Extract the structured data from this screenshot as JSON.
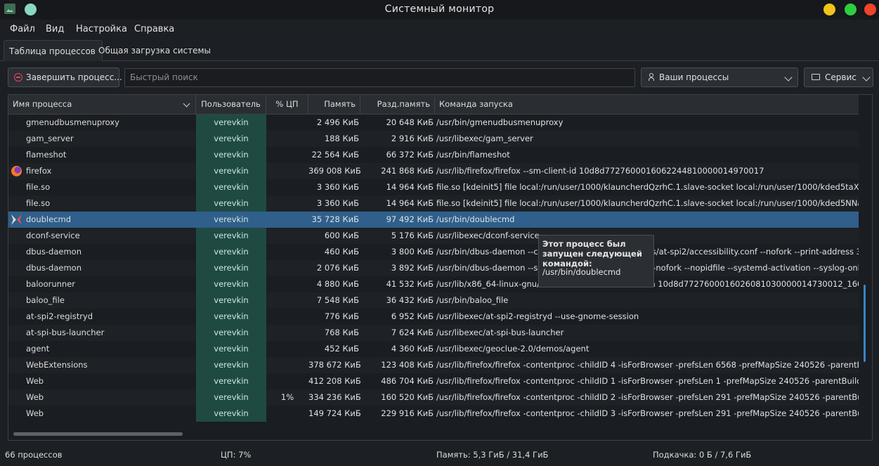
{
  "window": {
    "title": "Системный монитор"
  },
  "menu": [
    "Файл",
    "Вид",
    "Настройка",
    "Справка"
  ],
  "tabs": [
    "Таблица процессов",
    "Общая загрузка системы"
  ],
  "toolbar": {
    "kill_label": "Завершить процесс...",
    "search_placeholder": "Быстрый поиск",
    "filter_label": "Ваши процессы",
    "service_label": "Сервис"
  },
  "columns": [
    "Имя процесса",
    "Пользователь",
    "% ЦП",
    "Память",
    "Разд.память",
    "Команда запуска"
  ],
  "rows": [
    {
      "name": "gmenudbusmenuproxy",
      "user": "verevkin",
      "cpu": "",
      "mem": "2 496 КиБ",
      "shm": "20 648 КиБ",
      "cmd": "/usr/bin/gmenudbusmenuproxy",
      "icon": ""
    },
    {
      "name": "gam_server",
      "user": "verevkin",
      "cpu": "",
      "mem": "188 КиБ",
      "shm": "2 916 КиБ",
      "cmd": "/usr/libexec/gam_server",
      "icon": ""
    },
    {
      "name": "flameshot",
      "user": "verevkin",
      "cpu": "",
      "mem": "22 564 КиБ",
      "shm": "66 372 КиБ",
      "cmd": "/usr/bin/flameshot",
      "icon": ""
    },
    {
      "name": "firefox",
      "user": "verevkin",
      "cpu": "",
      "mem": "369 008 КиБ",
      "shm": "241 868 КиБ",
      "cmd": "/usr/lib/firefox/firefox --sm-client-id 10d8d7727600016062244810000014970017",
      "icon": "firefox-icon"
    },
    {
      "name": "file.so",
      "user": "verevkin",
      "cpu": "",
      "mem": "3 360 КиБ",
      "shm": "14 964 КиБ",
      "cmd": "file.so [kdeinit5] file local:/run/user/1000/klauncherdQzrhC.1.slave-socket local:/run/user/1000/kded5taXxH",
      "icon": ""
    },
    {
      "name": "file.so",
      "user": "verevkin",
      "cpu": "",
      "mem": "3 360 КиБ",
      "shm": "14 964 КиБ",
      "cmd": "file.so [kdeinit5] file local:/run/user/1000/klauncherdQzrhC.1.slave-socket local:/run/user/1000/kded5NNak",
      "icon": ""
    },
    {
      "name": "doublecmd",
      "user": "verevkin",
      "cpu": "",
      "mem": "35 728 КиБ",
      "shm": "97 492 КиБ",
      "cmd": "/usr/bin/doublecmd",
      "icon": "doublecmd-icon",
      "selected": true
    },
    {
      "name": "dconf-service",
      "user": "verevkin",
      "cpu": "",
      "mem": "600 КиБ",
      "shm": "5 176 КиБ",
      "cmd": "/usr/libexec/dconf-service",
      "icon": ""
    },
    {
      "name": "dbus-daemon",
      "user": "verevkin",
      "cpu": "",
      "mem": "460 КиБ",
      "shm": "3 800 КиБ",
      "cmd": "/usr/bin/dbus-daemon --config-file=/usr/share/defaults/at-spi2/accessibility.conf --nofork --print-address 3",
      "icon": ""
    },
    {
      "name": "dbus-daemon",
      "user": "verevkin",
      "cpu": "",
      "mem": "2 076 КиБ",
      "shm": "3 892 КиБ",
      "cmd": "/usr/bin/dbus-daemon --session --address=systemd: --nofork --nopidfile --systemd-activation --syslog-only",
      "icon": ""
    },
    {
      "name": "baloorunner",
      "user": "verevkin",
      "cpu": "",
      "mem": "4 880 КиБ",
      "shm": "41 532 КиБ",
      "cmd": "/usr/lib/x86_64-linux-gnu/libexec/baloorunner -session 10d8d7727600016026081030000014730012_1606",
      "icon": ""
    },
    {
      "name": "baloo_file",
      "user": "verevkin",
      "cpu": "",
      "mem": "7 548 КиБ",
      "shm": "36 432 КиБ",
      "cmd": "/usr/bin/baloo_file",
      "icon": ""
    },
    {
      "name": "at-spi2-registryd",
      "user": "verevkin",
      "cpu": "",
      "mem": "776 КиБ",
      "shm": "6 952 КиБ",
      "cmd": "/usr/libexec/at-spi2-registryd --use-gnome-session",
      "icon": ""
    },
    {
      "name": "at-spi-bus-launcher",
      "user": "verevkin",
      "cpu": "",
      "mem": "768 КиБ",
      "shm": "7 624 КиБ",
      "cmd": "/usr/libexec/at-spi-bus-launcher",
      "icon": ""
    },
    {
      "name": "agent",
      "user": "verevkin",
      "cpu": "",
      "mem": "452 КиБ",
      "shm": "4 360 КиБ",
      "cmd": "/usr/libexec/geoclue-2.0/demos/agent",
      "icon": ""
    },
    {
      "name": "WebExtensions",
      "user": "verevkin",
      "cpu": "",
      "mem": "378 672 КиБ",
      "shm": "123 408 КиБ",
      "cmd": "/usr/lib/firefox/firefox -contentproc -childID 4 -isForBrowser -prefsLen 6568 -prefMapSize 240526 -parentBui",
      "icon": ""
    },
    {
      "name": "Web",
      "user": "verevkin",
      "cpu": "",
      "mem": "412 208 КиБ",
      "shm": "486 704 КиБ",
      "cmd": "/usr/lib/firefox/firefox -contentproc -childID 1 -isForBrowser -prefsLen 1 -prefMapSize 240526 -parentBuildID",
      "icon": ""
    },
    {
      "name": "Web",
      "user": "verevkin",
      "cpu": "1%",
      "mem": "334 236 КиБ",
      "shm": "160 520 КиБ",
      "cmd": "/usr/lib/firefox/firefox -contentproc -childID 2 -isForBrowser -prefsLen 291 -prefMapSize 240526 -parentBuil",
      "icon": ""
    },
    {
      "name": "Web",
      "user": "verevkin",
      "cpu": "",
      "mem": "149 724 КиБ",
      "shm": "229 916 КиБ",
      "cmd": "/usr/lib/firefox/firefox -contentproc -childID 3 -isForBrowser -prefsLen 291 -prefMapSize 240526 -parentBuil",
      "icon": ""
    }
  ],
  "tooltip": {
    "heading": "Этот процесс был запущен следующей командой:",
    "command": "/usr/bin/doublecmd"
  },
  "status": {
    "processes": "66 процессов",
    "cpu": "ЦП: 7%",
    "memory": "Память: 5,3 ГиБ / 31,4 ГиБ",
    "swap": "Подкачка: 0 Б / 7,6 ГиБ"
  },
  "colors": {
    "selection": "#2f5f8a",
    "user_column": "#1f4a44",
    "scroll_accent": "#3a84c9"
  }
}
